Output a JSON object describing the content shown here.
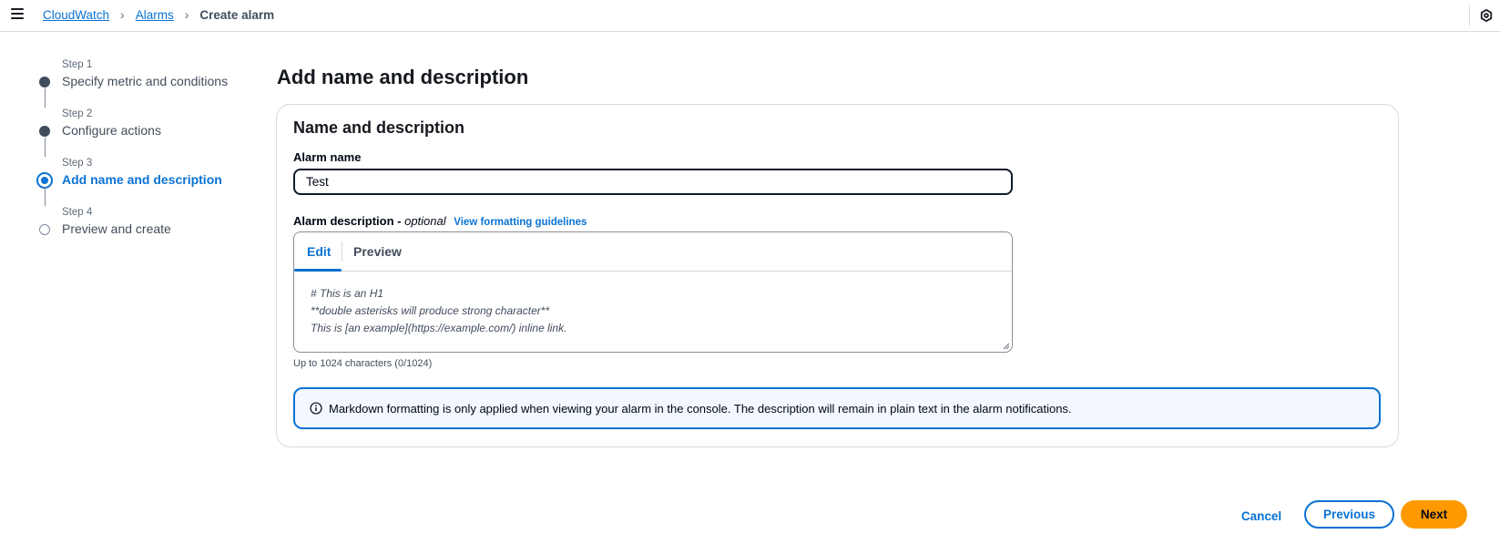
{
  "breadcrumb": {
    "items": [
      {
        "label": "CloudWatch"
      },
      {
        "label": "Alarms"
      },
      {
        "label": "Create alarm"
      }
    ]
  },
  "steps": [
    {
      "num": "Step 1",
      "label": "Specify metric and conditions",
      "state": "complete"
    },
    {
      "num": "Step 2",
      "label": "Configure actions",
      "state": "complete"
    },
    {
      "num": "Step 3",
      "label": "Add name and description",
      "state": "current"
    },
    {
      "num": "Step 4",
      "label": "Preview and create",
      "state": "pending"
    }
  ],
  "main": {
    "title": "Add name and description",
    "panel_title": "Name and description",
    "alarm_name_label": "Alarm name",
    "alarm_name_value": "Test",
    "description_label": "Alarm description -",
    "description_optional": "optional",
    "formatting_link": "View formatting guidelines",
    "tabs": [
      {
        "label": "Edit",
        "active": true
      },
      {
        "label": "Preview",
        "active": false
      }
    ],
    "description_placeholder": "# This is an H1\n**double asterisks will produce strong character**\nThis is [an example](https://example.com/) inline link.",
    "char_hint": "Up to 1024 characters (0/1024)",
    "info_text": "Markdown formatting is only applied when viewing your alarm in the console. The description will remain in plain text in the alarm notifications."
  },
  "footer": {
    "cancel_label": "Cancel",
    "previous_label": "Previous",
    "next_label": "Next"
  },
  "colors": {
    "accent": "#0972d3",
    "primary_button": "#ff9900",
    "info_background": "#f2f8fd"
  },
  "icons": {
    "menu": "hamburger-menu-icon",
    "settings": "settings-icon",
    "info": "info-icon"
  }
}
